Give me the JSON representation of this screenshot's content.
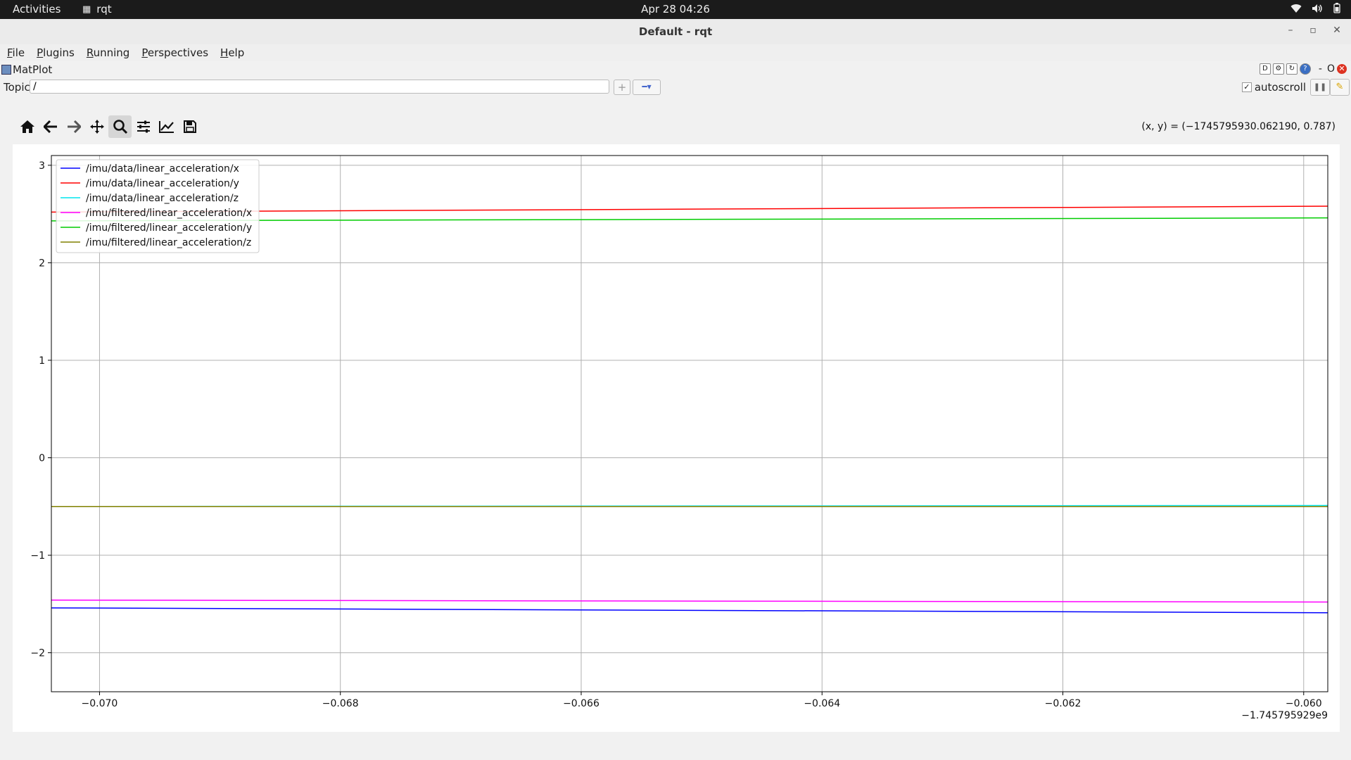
{
  "topbar": {
    "activities": "Activities",
    "app_name": "rqt",
    "clock": "Apr 28  04:26",
    "icons": [
      "wifi-icon",
      "volume-icon",
      "battery-icon"
    ]
  },
  "window": {
    "title": "Default - rqt",
    "controls": [
      "–",
      "▫",
      "✕"
    ]
  },
  "menubar": {
    "items": [
      {
        "first": "F",
        "rest": "ile"
      },
      {
        "first": "P",
        "rest": "lugins"
      },
      {
        "first": "R",
        "rest": "unning"
      },
      {
        "first": "P",
        "rest": "erspectives"
      },
      {
        "first": "H",
        "rest": "elp"
      }
    ]
  },
  "plugin": {
    "name": "MatPlot",
    "ctrl_d": "D",
    "ctrl_dash": "-",
    "ctrl_o": "O"
  },
  "topic": {
    "label": "Topic",
    "value": "/",
    "add_symbol": "+",
    "remove_symbol": "━▾",
    "autoscroll_label": "autoscroll",
    "autoscroll_checked": "✓"
  },
  "toolbar": {
    "icons": [
      "home-icon",
      "back-arrow-icon",
      "forward-arrow-icon",
      "pan-icon",
      "zoom-icon",
      "subplots-config-icon",
      "edit-axis-icon",
      "save-icon"
    ],
    "active": "zoom-icon"
  },
  "coords_readout": "(x, y) = (−1745795930.062190, 0.787)",
  "chart_data": {
    "type": "line",
    "x_offset_label": "−1.745795929e9",
    "xlim": [
      -0.0704,
      -0.0598
    ],
    "ylim": [
      -2.4,
      3.1
    ],
    "xticks": [
      -0.07,
      -0.068,
      -0.066,
      -0.064,
      -0.062,
      -0.06
    ],
    "xtick_labels": [
      "−0.070",
      "−0.068",
      "−0.066",
      "−0.064",
      "−0.062",
      "−0.060"
    ],
    "yticks": [
      -2,
      -1,
      0,
      1,
      2,
      3
    ],
    "ytick_labels": [
      "−2",
      "−1",
      "0",
      "1",
      "2",
      "3"
    ],
    "grid": true,
    "legend_position": "top-left",
    "series": [
      {
        "name": "/imu/data/linear_acceleration/x",
        "color": "#0000ff",
        "x": [
          -0.0704,
          -0.0598
        ],
        "y": [
          -1.54,
          -1.59
        ]
      },
      {
        "name": "/imu/data/linear_acceleration/y",
        "color": "#ff0000",
        "x": [
          -0.0704,
          -0.0598
        ],
        "y": [
          2.52,
          2.58
        ]
      },
      {
        "name": "/imu/data/linear_acceleration/z",
        "color": "#00e5ee",
        "x": [
          -0.0704,
          -0.0598
        ],
        "y": [
          -0.5,
          -0.49
        ]
      },
      {
        "name": "/imu/filtered/linear_acceleration/x",
        "color": "#ff00ff",
        "x": [
          -0.0704,
          -0.0598
        ],
        "y": [
          -1.46,
          -1.48
        ]
      },
      {
        "name": "/imu/filtered/linear_acceleration/y",
        "color": "#00cc00",
        "x": [
          -0.0704,
          -0.0598
        ],
        "y": [
          2.43,
          2.46
        ]
      },
      {
        "name": "/imu/filtered/linear_acceleration/z",
        "color": "#808000",
        "x": [
          -0.0704,
          -0.0598
        ],
        "y": [
          -0.5,
          -0.5
        ]
      }
    ]
  }
}
